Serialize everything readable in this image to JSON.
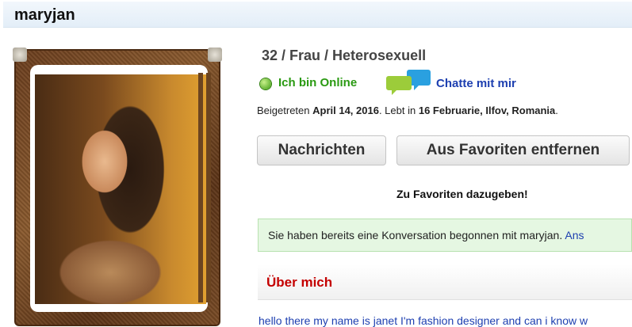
{
  "profile": {
    "username": "maryjan",
    "summary": "32 / Frau / Heterosexuell",
    "online_status": "Ich bin Online",
    "chat_link": "Chatte mit mir",
    "joined": {
      "prefix": "Beigetreten",
      "date": "April 14, 2016",
      "middle": ". Lebt in",
      "location": "16 Februarie, Ilfov, Romania",
      "suffix": "."
    }
  },
  "actions": {
    "messages_label": "Nachrichten",
    "favorites_label": "Aus Favoriten entfernen",
    "favorites_added": "Zu Favoriten dazugeben!"
  },
  "notice": {
    "text": "Sie haben bereits eine Konversation begonnen mit maryjan.",
    "link": "Ans"
  },
  "about": {
    "title": "Über mich",
    "bio": "hello there my name is janet I'm fashion designer and can i know w"
  },
  "colors": {
    "online_green": "#2a9a12",
    "link_blue": "#1d3fb0",
    "section_red": "#c40000",
    "notice_bg": "#e5f7e2"
  },
  "icons": {
    "online": "green-dot-icon",
    "chat": "chat-bubbles-icon"
  }
}
